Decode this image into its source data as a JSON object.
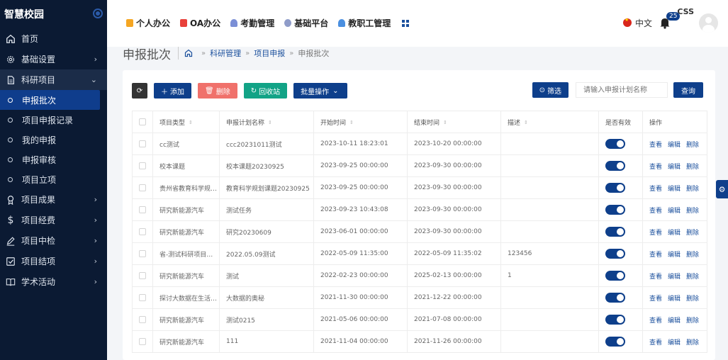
{
  "brand": {
    "title": "智慧校园"
  },
  "sidebar": {
    "items": [
      {
        "label": "首页",
        "icon": "home-icon"
      },
      {
        "label": "基础设置",
        "icon": "gear-icon"
      },
      {
        "label": "科研项目",
        "icon": "document-icon",
        "open": true,
        "children": [
          "申报批次",
          "项目申报记录",
          "我的申报",
          "申报审核",
          "项目立项"
        ]
      },
      {
        "label": "项目成果",
        "icon": "award-icon"
      },
      {
        "label": "项目经费",
        "icon": "dollar-icon"
      },
      {
        "label": "项目中检",
        "icon": "pen-icon"
      },
      {
        "label": "项目结项",
        "icon": "check-square-icon"
      },
      {
        "label": "学术活动",
        "icon": "book-icon"
      }
    ]
  },
  "topnav": {
    "items": [
      "个人办公",
      "OA办公",
      "考勤管理",
      "基础平台",
      "教职工管理"
    ]
  },
  "topright": {
    "language": "中文",
    "notifications": "25",
    "username": "CSS"
  },
  "page": {
    "title": "申报批次",
    "breadcrumb": [
      "科研管理",
      "项目申报",
      "申报批次"
    ]
  },
  "toolbar": {
    "add": "添加",
    "delete": "删除",
    "recycle": "回收站",
    "batch": "批量操作",
    "filter": "筛选",
    "search_placeholder": "请输入申报计划名称",
    "query": "查询"
  },
  "table": {
    "headers": [
      "项目类型",
      "申报计划名称",
      "开始时间",
      "结束时间",
      "描述",
      "是否有效",
      "操作"
    ],
    "ops": [
      "查看",
      "编辑",
      "删除"
    ],
    "rows": [
      [
        "cc测试",
        "ccc20231011测试",
        "2023-10-11 18:23:01",
        "2023-10-20 00:00:00",
        ""
      ],
      [
        "校本课题",
        "校本课题20230925",
        "2023-09-25 00:00:00",
        "2023-09-30 00:00:00",
        ""
      ],
      [
        "贵州省教育科学规划课题",
        "教育科学规划课题20230925",
        "2023-09-25 00:00:00",
        "2023-09-30 00:00:00",
        ""
      ],
      [
        "研究新能源汽车",
        "测试任务",
        "2023-09-23 10:43:08",
        "2023-09-30 00:00:00",
        ""
      ],
      [
        "研究新能源汽车",
        "研究20230609",
        "2023-06-01 00:00:00",
        "2023-09-30 00:00:00",
        ""
      ],
      [
        "省-测试科研项目类型",
        "2022.05.09测试",
        "2022-05-09 11:35:00",
        "2022-05-09 11:35:02",
        "123456"
      ],
      [
        "研究新能源汽车",
        "测试",
        "2022-02-23 00:00:00",
        "2025-02-13 00:00:00",
        "1"
      ],
      [
        "探讨大数据在生活中的应用",
        "大数据的奥秘",
        "2021-11-30 00:00:00",
        "2021-12-22 00:00:00",
        ""
      ],
      [
        "研究新能源汽车",
        "测试0215",
        "2021-05-06 00:00:00",
        "2021-07-08 00:00:00",
        ""
      ],
      [
        "研究新能源汽车",
        "111",
        "2021-11-04 00:00:00",
        "2021-11-26 00:00:00",
        ""
      ]
    ]
  },
  "colors": {
    "sidebar_bg": "#0b1a33",
    "primary": "#0e3f8b",
    "danger": "#f0716b",
    "success": "#12a386"
  }
}
